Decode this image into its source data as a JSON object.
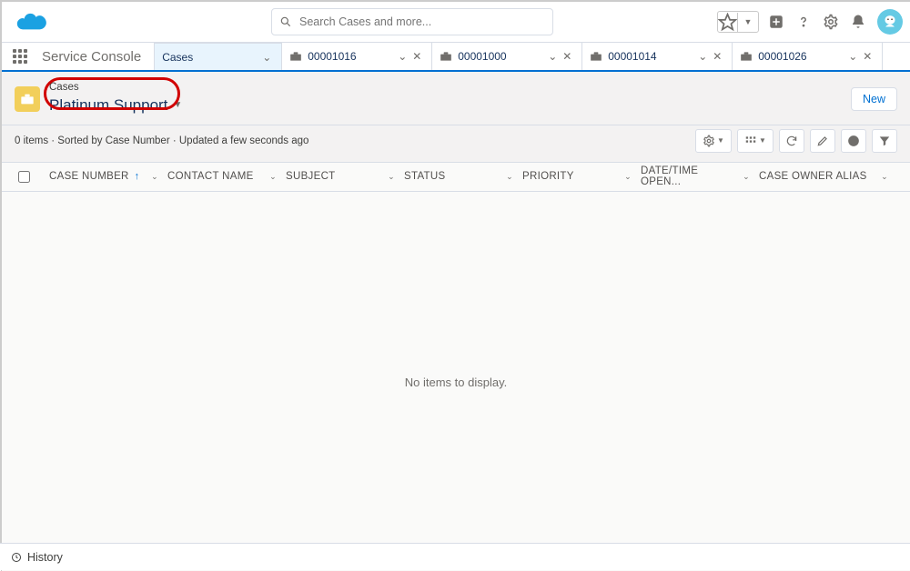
{
  "search": {
    "placeholder": "Search Cases and more..."
  },
  "app_name": "Service Console",
  "nav_tabs": {
    "primary": "Cases",
    "work_tabs": [
      "00001016",
      "00001000",
      "00001014",
      "00001026"
    ]
  },
  "page_header": {
    "object_label": "Cases",
    "listview_name": "Platinum Support",
    "new_button": "New"
  },
  "meta_line": "0 items · Sorted by Case Number · Updated a few seconds ago",
  "columns": {
    "case_number": "CASE NUMBER",
    "contact_name": "CONTACT NAME",
    "subject": "SUBJECT",
    "status": "STATUS",
    "priority": "PRIORITY",
    "dt_open": "DATE/TIME OPEN...",
    "owner_alias": "CASE OWNER ALIAS"
  },
  "empty_message": "No items to display.",
  "footer": {
    "history": "History"
  }
}
